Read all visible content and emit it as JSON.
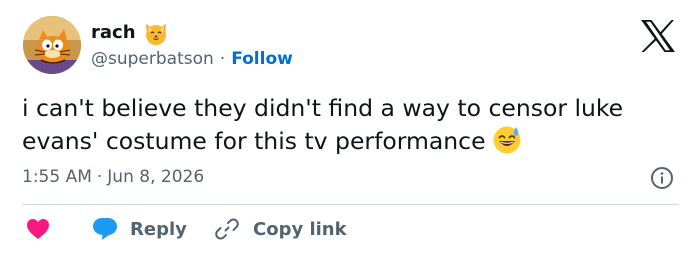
{
  "author": {
    "display_name": "rach",
    "name_emoji": "cat-face-emoji",
    "handle": "@superbatson",
    "separator": "·",
    "follow_label": "Follow",
    "avatar": "garfield-cartoon-avatar"
  },
  "platform_logo": "x-logo",
  "tweet": {
    "text_line_1": "i can't believe they didn't find a way to censor luke",
    "text_line_2": "evans' costume for this tv performance",
    "emoji": "grinning-face-with-sweat-emoji"
  },
  "meta": {
    "time": "1:55 AM",
    "separator": "·",
    "date": "Jun 8, 2026",
    "info_icon": "info-icon"
  },
  "actions": {
    "like_icon": "heart-icon",
    "reply_icon": "speech-bubble-icon",
    "reply_label": "Reply",
    "copy_icon": "link-icon",
    "copy_label": "Copy link"
  },
  "colors": {
    "text": "#0f1419",
    "secondary": "#536471",
    "link": "#006fd6",
    "like": "#f91880",
    "reply": "#1d9bf0",
    "divider": "#cfd9de"
  }
}
